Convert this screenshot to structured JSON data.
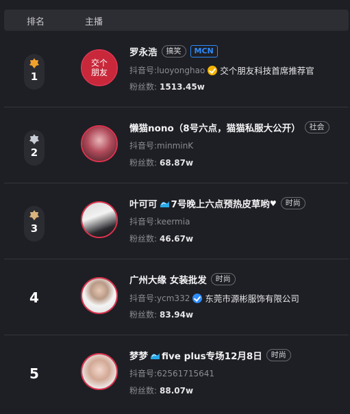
{
  "header": {
    "rank_label": "排名",
    "anchor_label": "主播"
  },
  "label_douyin_id": "抖音号:",
  "label_fans": "粉丝数:",
  "rows": [
    {
      "rank": "1",
      "name": "罗永浩",
      "tags": [
        "搞笑",
        "MCN"
      ],
      "douyin_id": "luoyonghao",
      "cert": "交个朋友科技首席推荐官",
      "fans": "1513.45w",
      "avatar_text": "交个朋友"
    },
    {
      "rank": "2",
      "name": "懒猫nono（8号六点，猫猫私服大公开）",
      "tags": [
        "社会"
      ],
      "douyin_id": "minminK",
      "fans": "68.87w"
    },
    {
      "rank": "3",
      "name_prefix": "叶可可",
      "name_suffix": "7号晚上六点预热皮草哟",
      "tags": [
        "时尚"
      ],
      "douyin_id": "keermia",
      "fans": "46.67w"
    },
    {
      "rank": "4",
      "name": "广州大缘 女装批发",
      "tags": [
        "时尚"
      ],
      "douyin_id": "ycm332",
      "cert": "东莞市源彬服饰有限公司",
      "fans": "83.94w"
    },
    {
      "rank": "5",
      "name_prefix": "梦梦",
      "name_suffix": "five plus专场12月8日",
      "tags": [
        "时尚"
      ],
      "douyin_id": "62561715641",
      "fans": "88.07w"
    }
  ],
  "colors": {
    "avatar_border": "#e0334f",
    "mcn": "#2d8cff",
    "verified_gold": "#f5b301",
    "verified_blue": "#2d8cff"
  },
  "icons": {
    "rank1": "gold-medal-icon",
    "rank2": "silver-medal-icon",
    "rank3": "bronze-medal-icon"
  }
}
